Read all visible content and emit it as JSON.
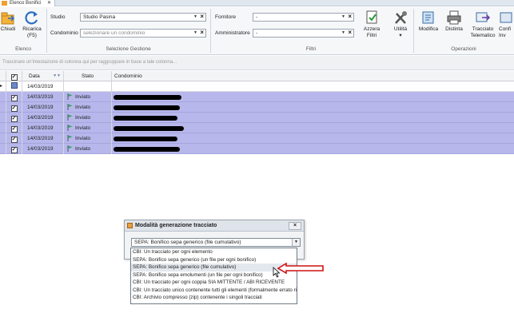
{
  "tab": {
    "label": "Elenco Bonifici",
    "close": "✕"
  },
  "ribbon": {
    "chiudi": "Chiudi",
    "ricarica": [
      "Ricarica",
      "(F5)"
    ],
    "elenco_group": "Elenco",
    "studio_label": "Studio",
    "studio_value": "Studio Pasina",
    "condominio_label": "Condominio",
    "condominio_placeholder": "selezionare un condominio",
    "selezione_group": "Selezione Gestione",
    "fornitore_label": "Fornitore",
    "fornitore_value": "-",
    "amministratore_label": "Amministratore",
    "amministratore_value": "-",
    "azzera": [
      "Azzera",
      "Filtri"
    ],
    "utilita": "Utilità",
    "filtri_group": "Filtri",
    "modifica": "Modifica",
    "distinta": "Distinta",
    "tracciato": [
      "Tracciato",
      "Telematico"
    ],
    "conf": [
      "Confi",
      "Inv"
    ],
    "operazioni_group": "Operazioni"
  },
  "grid": {
    "group_hint": "Trascinare un'intestazione di colonna qui per raggruppare in base a tale colonna...",
    "col_data": "Data",
    "col_stato": "Stato",
    "col_condominio": "Condominio",
    "filter_date": "14/03/2019",
    "rows": [
      {
        "data": "14/03/2019",
        "stato": "Inviato"
      },
      {
        "data": "14/03/2019",
        "stato": "Inviato"
      },
      {
        "data": "14/03/2019",
        "stato": "Inviato"
      },
      {
        "data": "14/03/2019",
        "stato": "Inviato"
      },
      {
        "data": "14/03/2019",
        "stato": "Inviato"
      },
      {
        "data": "14/03/2019",
        "stato": "Inviato"
      }
    ]
  },
  "dialog": {
    "title": "Modalità generazione tracciato",
    "selected": "SEPA: Bonifico sepa generico (file cumulativo)",
    "options": [
      "CBI: Un tracciato per ogni elemento",
      "SEPA: Bonifico sepa generico (un file per ogni bonifico)",
      "SEPA: Bonifico sepa generico (file cumulativo)",
      "SEPA: Bonifico sepa emolumenti (un file per ogni bonifico)",
      "CBI: Un tracciato per ogni coppia SIA MITTENTE / ABI RICEVENTE",
      "CBI: Un tracciato unico contenente tutti gli elementi (formalmente errato rispetto alle specifiche CBI)",
      "CBI: Archivio compresso (zip) contenente i singoli tracciati"
    ]
  },
  "colors": {
    "selected_row": "#b7b7ec",
    "flag": "#3a9a6a",
    "arrow": "#d01010"
  }
}
